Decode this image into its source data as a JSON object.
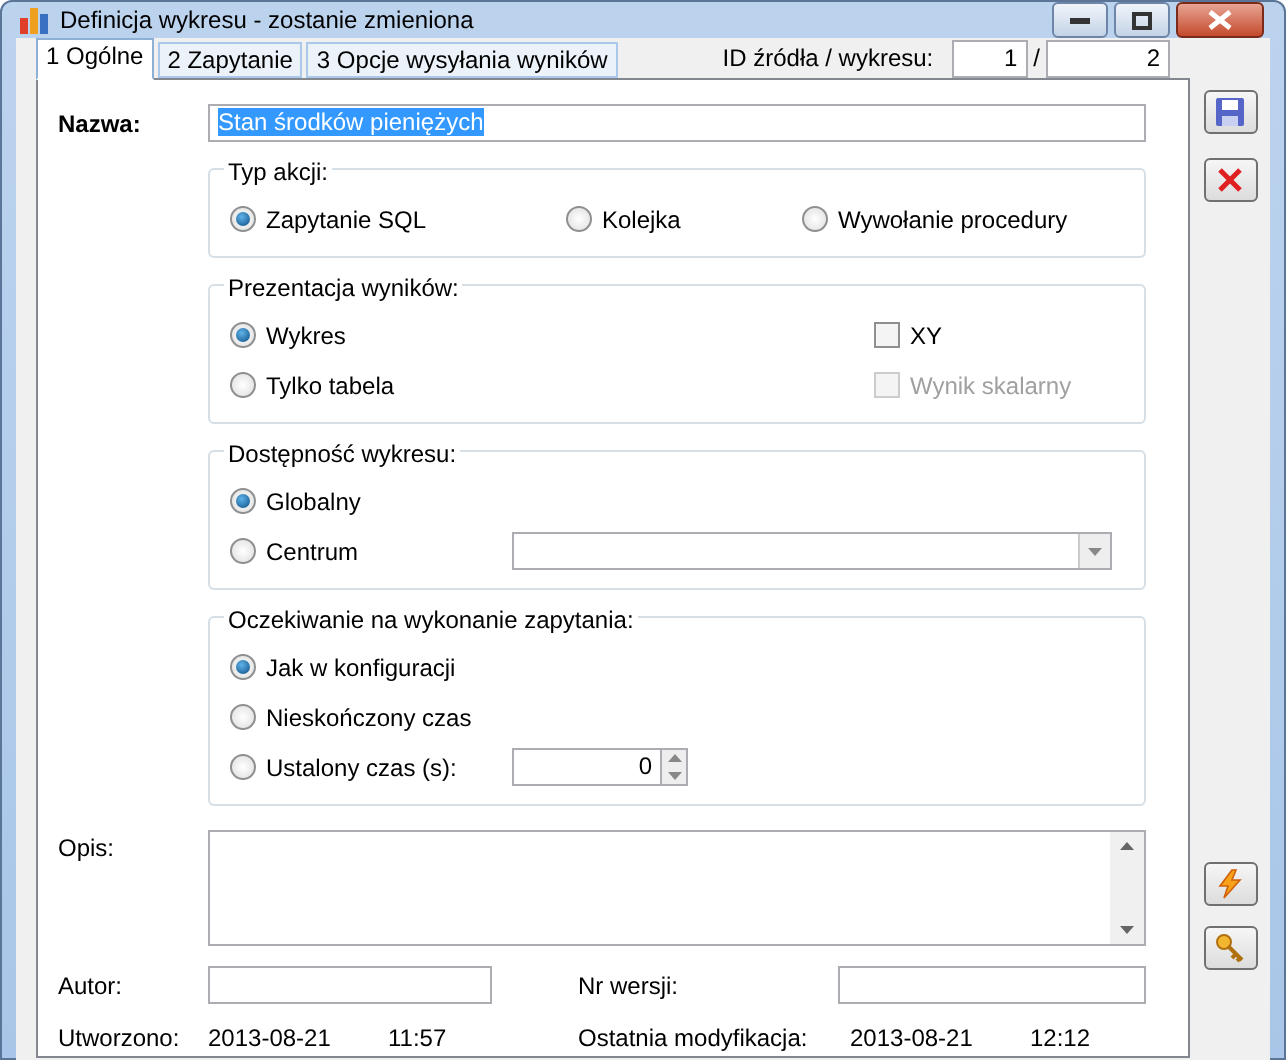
{
  "window": {
    "title": "Definicja wykresu - zostanie zmieniona"
  },
  "tabs": [
    {
      "label": "1 Ogólne",
      "selected": true
    },
    {
      "label": "2 Zapytanie",
      "selected": false
    },
    {
      "label": "3 Opcje wysyłania wyników",
      "selected": false
    }
  ],
  "id_fields": {
    "label": "ID źródła / wykresu:",
    "source": "1",
    "separator": "/",
    "chart": "2"
  },
  "name": {
    "label": "Nazwa:",
    "value": "Stan środków pieniężych",
    "highlighted": true
  },
  "action_type": {
    "title": "Typ akcji:",
    "options": [
      {
        "label": "Zapytanie SQL",
        "selected": true
      },
      {
        "label": "Kolejka",
        "selected": false
      },
      {
        "label": "Wywołanie procedury",
        "selected": false
      }
    ]
  },
  "presentation": {
    "title": "Prezentacja wyników:",
    "options": [
      {
        "label": "Wykres",
        "selected": true
      },
      {
        "label": "Tylko tabela",
        "selected": false
      }
    ],
    "checkboxes": [
      {
        "label": "XY",
        "checked": false,
        "disabled": false
      },
      {
        "label": "Wynik skalarny",
        "checked": false,
        "disabled": true
      }
    ]
  },
  "availability": {
    "title": "Dostępność wykresu:",
    "options": [
      {
        "label": "Globalny",
        "selected": true,
        "kind": "plain"
      },
      {
        "label": "Centrum",
        "selected": false,
        "kind": "dropdown"
      }
    ]
  },
  "waiting": {
    "title": "Oczekiwanie na wykonanie zapytania:",
    "options": [
      {
        "label": "Jak w konfiguracji",
        "selected": true,
        "kind": "plain"
      },
      {
        "label": "Nieskończony czas",
        "selected": false,
        "kind": "plain"
      },
      {
        "label": "Ustalony czas (s):",
        "selected": false,
        "kind": "spinner",
        "value": "0"
      }
    ]
  },
  "description": {
    "label": "Opis:"
  },
  "author": {
    "label": "Autor:"
  },
  "version": {
    "label": "Nr wersji:"
  },
  "created": {
    "label": "Utworzono:",
    "date": "2013-08-21",
    "time": "11:57"
  },
  "modified": {
    "label": "Ostatnia modyfikacja:",
    "date": "2013-08-21",
    "time": "12:12"
  },
  "side_buttons": [
    {
      "kind": "save"
    },
    {
      "kind": "delete"
    },
    {
      "kind": "run"
    },
    {
      "kind": "key"
    }
  ]
}
